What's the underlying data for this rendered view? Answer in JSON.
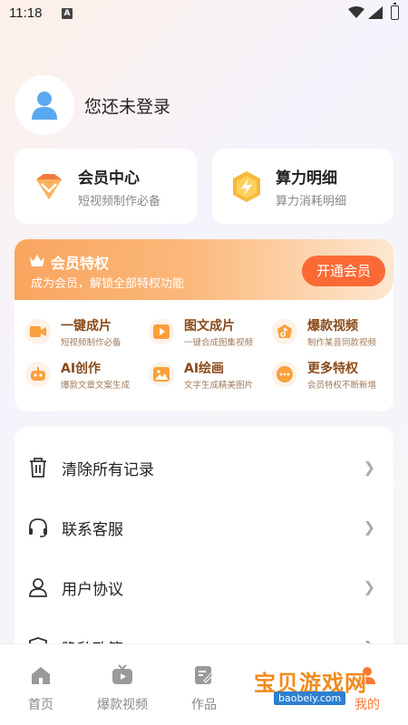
{
  "status_bar": {
    "time": "11:18",
    "notification_glyph": "A"
  },
  "profile": {
    "login_text": "您还未登录"
  },
  "cards": {
    "vip": {
      "title": "会员中心",
      "subtitle": "短视频制作必备"
    },
    "power": {
      "title": "算力明细",
      "subtitle": "算力消耗明细"
    }
  },
  "privilege": {
    "title": "会员特权",
    "subtitle": "成为会员，解锁全部特权功能",
    "button": "开通会员",
    "features": [
      {
        "title": "一键成片",
        "subtitle": "短视频制作必备",
        "icon": "video-camera-icon"
      },
      {
        "title": "图文成片",
        "subtitle": "一键合成图集视频",
        "icon": "play-film-icon"
      },
      {
        "title": "爆款视频",
        "subtitle": "制作某音同款视频",
        "icon": "tiktok-icon"
      },
      {
        "title": "AI创作",
        "subtitle": "爆款文章文案生成",
        "icon": "robot-icon"
      },
      {
        "title": "AI绘画",
        "subtitle": "文字生成精美图片",
        "icon": "image-icon"
      },
      {
        "title": "更多特权",
        "subtitle": "会员特权不断新增",
        "icon": "more-dots-icon"
      }
    ]
  },
  "menu": {
    "items": [
      {
        "label": "清除所有记录",
        "icon": "trash-icon"
      },
      {
        "label": "联系客服",
        "icon": "headset-icon"
      },
      {
        "label": "用户协议",
        "icon": "user-icon"
      },
      {
        "label": "隐私政策",
        "icon": "shield-icon"
      }
    ]
  },
  "tabs": [
    {
      "label": "首页",
      "icon": "home-icon"
    },
    {
      "label": "爆款视频",
      "icon": "tv-icon"
    },
    {
      "label": "作品",
      "icon": "edit-doc-icon"
    },
    {
      "label": "我的",
      "icon": "profile-icon",
      "active": true
    }
  ],
  "watermark": {
    "title": "宝贝游戏网",
    "url": "baobeiy.com"
  },
  "colors": {
    "accent": "#fb6a35",
    "privilege_gradient_start": "#f9a55f",
    "feature_text": "#8a4a1a"
  }
}
